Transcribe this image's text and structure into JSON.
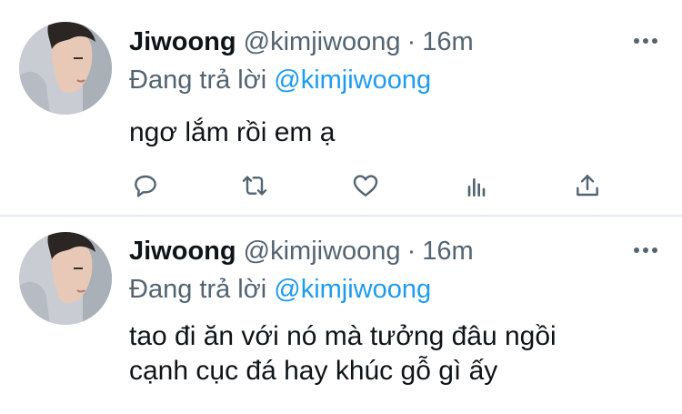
{
  "tweets": [
    {
      "author_name": "Jiwoong",
      "handle": "@kimjiwoong",
      "separator": "·",
      "time": "16m",
      "reply_prefix": "Đang trả lời ",
      "reply_to": "@kimjiwoong",
      "text_lines": [
        "ngơ lắm rồi em ạ"
      ],
      "actions": [
        "reply-icon",
        "retweet-icon",
        "like-icon",
        "analytics-icon",
        "share-icon"
      ]
    },
    {
      "author_name": "Jiwoong",
      "handle": "@kimjiwoong",
      "separator": "·",
      "time": "16m",
      "reply_prefix": "Đang trả lời ",
      "reply_to": "@kimjiwoong",
      "text_lines": [
        "tao đi ăn với nó mà tưởng đâu ngồi",
        "cạnh cục đá hay khúc gỗ gì ấy"
      ]
    }
  ],
  "colors": {
    "text": "#0f1419",
    "secondary": "#536471",
    "mention": "#1d9bf0",
    "divider": "#e6ecf0"
  }
}
